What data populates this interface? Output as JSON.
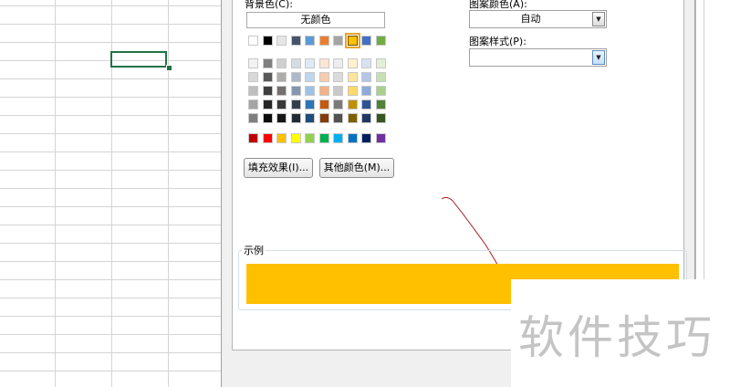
{
  "dialog": {
    "background_color_label": "背景色(C):",
    "no_color_label": "无颜色",
    "fill_effects_label": "填充效果(I)...",
    "more_colors_label": "其他颜色(M)...",
    "pattern_color_label": "图案颜色(A):",
    "pattern_color_value": "自动",
    "pattern_style_label": "图案样式(P):",
    "pattern_style_value": "",
    "sample_label": "示例",
    "sample_color": "#FFC000"
  },
  "palette": {
    "theme_top": [
      "#FFFFFF",
      "#000000",
      "#E7E6E6",
      "#44546A",
      "#5B9BD5",
      "#ED7D31",
      "#A5A5A5",
      "#FFC000",
      "#4472C4",
      "#70AD47"
    ],
    "tints": [
      [
        "#F2F2F2",
        "#7F7F7F",
        "#D0CECE",
        "#D6DCE4",
        "#DEEBF6",
        "#FBE5D5",
        "#EDEDED",
        "#FFF2CC",
        "#D9E2F3",
        "#E2EFD9"
      ],
      [
        "#D8D8D8",
        "#595959",
        "#AEABAB",
        "#ADB9CA",
        "#BDD7EE",
        "#F7CBAC",
        "#DBDBDB",
        "#FEE599",
        "#B4C6E7",
        "#C5E0B3"
      ],
      [
        "#BFBFBF",
        "#3F3F3F",
        "#757070",
        "#8496B0",
        "#9CC3E5",
        "#F4B183",
        "#C9C9C9",
        "#FFD965",
        "#8EAADB",
        "#A8D08D"
      ],
      [
        "#A5A5A5",
        "#262626",
        "#3A3838",
        "#323F4F",
        "#2E75B5",
        "#C55A11",
        "#7B7B7B",
        "#BF9000",
        "#2F5496",
        "#538135"
      ],
      [
        "#7F7F7F",
        "#0C0C0C",
        "#171616",
        "#222A35",
        "#1E4E79",
        "#843C0C",
        "#525252",
        "#7F6000",
        "#1F3864",
        "#375623"
      ]
    ],
    "standard": [
      "#C00000",
      "#FF0000",
      "#FFC000",
      "#FFFF00",
      "#92D050",
      "#00B050",
      "#00B0F0",
      "#0070C0",
      "#002060",
      "#7030A0"
    ],
    "selected_color": "#FFC000"
  },
  "watermark": {
    "text": "软件技巧"
  }
}
